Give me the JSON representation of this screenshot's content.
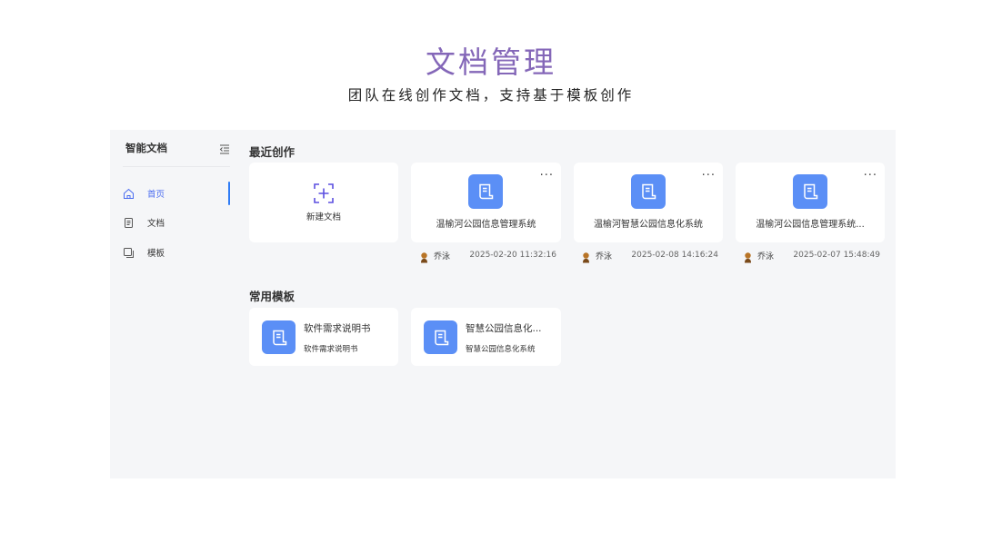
{
  "slide": {
    "title": "文档管理",
    "subtitle": "团队在线创作文档，支持基于模板创作"
  },
  "sidebar": {
    "title": "智能文档",
    "items": [
      {
        "label": "首页",
        "icon": "home-icon",
        "active": true
      },
      {
        "label": "文档",
        "icon": "document-icon",
        "active": false
      },
      {
        "label": "模板",
        "icon": "template-icon",
        "active": false
      }
    ]
  },
  "recent": {
    "title": "最近创作",
    "new_label": "新建文档",
    "docs": [
      {
        "name": "温榆河公园信息管理系统",
        "author": "乔泳",
        "time": "2025-02-20 11:32:16"
      },
      {
        "name": "温榆河智慧公园信息化系统",
        "author": "乔泳",
        "time": "2025-02-08 14:16:24"
      },
      {
        "name": "温榆河公园信息管理系统...",
        "author": "乔泳",
        "time": "2025-02-07 15:48:49"
      }
    ]
  },
  "templates": {
    "title": "常用模板",
    "items": [
      {
        "name": "软件需求说明书",
        "desc": "软件需求说明书"
      },
      {
        "name": "智慧公园信息化...",
        "desc": "智慧公园信息化系统"
      }
    ]
  },
  "colors": {
    "title": "#8467b8",
    "accent": "#2f7cf6",
    "icon_bg": "#5b8ff6",
    "app_bg": "#f5f6f8"
  },
  "more_glyph": "···"
}
